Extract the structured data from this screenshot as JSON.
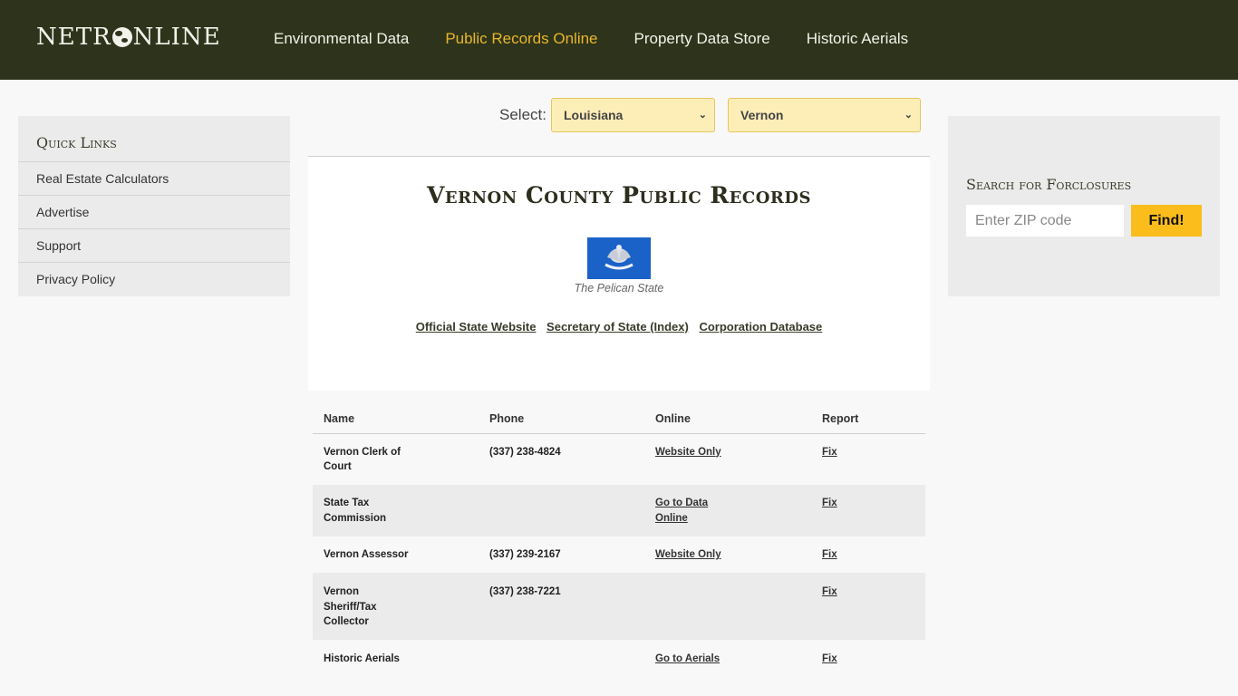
{
  "header": {
    "logo_left": "NETR",
    "logo_right": "NLINE",
    "nav": [
      {
        "label": "Environmental Data",
        "active": false
      },
      {
        "label": "Public Records Online",
        "active": true
      },
      {
        "label": "Property Data Store",
        "active": false
      },
      {
        "label": "Historic Aerials",
        "active": false
      }
    ]
  },
  "quick_links": {
    "title": "Quick Links",
    "items": [
      "Real Estate Calculators",
      "Advertise",
      "Support",
      "Privacy Policy"
    ]
  },
  "selector": {
    "label": "Select:",
    "state": "Louisiana",
    "county": "Vernon"
  },
  "main": {
    "title": "Vernon County Public Records",
    "flag_icon": "louisiana-flag",
    "motto": "The Pelican State",
    "links": [
      "Official State Website",
      "Secretary of State (Index)",
      "Corporation Database"
    ]
  },
  "foreclosure": {
    "title": "Search for Forclosures",
    "placeholder": "Enter ZIP code",
    "button": "Find!"
  },
  "table": {
    "headers": [
      "Name",
      "Phone",
      "Online",
      "Report"
    ],
    "rows": [
      {
        "name": "Vernon Clerk of Court",
        "phone": "(337) 238-4824",
        "online": "Website Only",
        "report": "Fix"
      },
      {
        "name": "State Tax Commission",
        "phone": "",
        "online": "Go to Data Online",
        "report": "Fix"
      },
      {
        "name": "Vernon Assessor",
        "phone": "(337) 239-2167",
        "online": "Website Only",
        "report": "Fix"
      },
      {
        "name": "Vernon Sheriff/Tax Collector",
        "phone": "(337) 238-7221",
        "online": "",
        "report": "Fix"
      },
      {
        "name": "Historic Aerials",
        "phone": "",
        "online": "Go to Aerials",
        "report": "Fix"
      }
    ]
  },
  "colors": {
    "header_bg": "#2e341b",
    "nav_active": "#e8b62c",
    "select_bg": "#fdeeb8",
    "find_button": "#fbbd1c",
    "flag_blue": "#1a62c8"
  }
}
